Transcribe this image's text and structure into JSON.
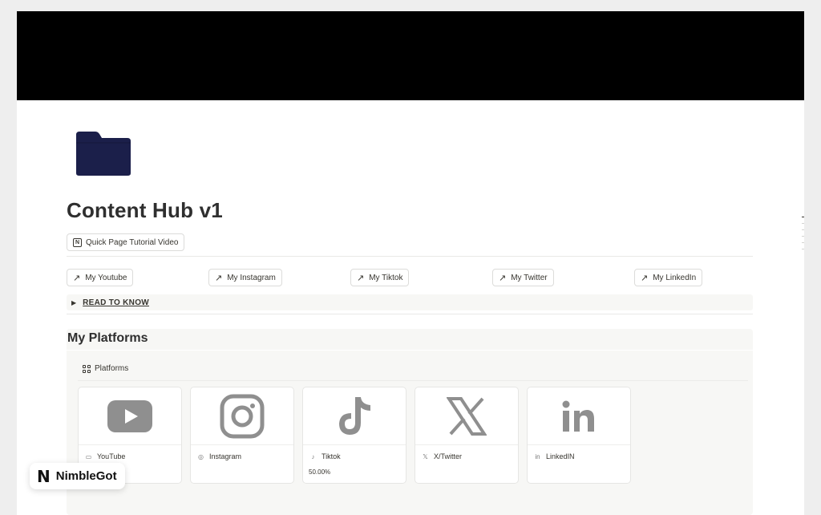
{
  "page": {
    "title": "Content Hub v1",
    "cover_color": "#000000",
    "icon": "folder-icon",
    "icon_color": "#1b1f4a"
  },
  "tutorial": {
    "label": "Quick Page Tutorial Video",
    "icon": "notion-logo-icon"
  },
  "links": [
    {
      "label": "My Youtube",
      "icon": "arrow-up-right-icon"
    },
    {
      "label": "My Instagram",
      "icon": "arrow-up-right-icon"
    },
    {
      "label": "My Tiktok",
      "icon": "arrow-up-right-icon"
    },
    {
      "label": "My Twitter",
      "icon": "arrow-up-right-icon"
    },
    {
      "label": "My LinkedIn",
      "icon": "arrow-up-right-icon"
    }
  ],
  "toggle": {
    "label": "READ TO KNOW",
    "icon": "triangle-right-icon"
  },
  "platforms_section": {
    "title": "My Platforms",
    "view_label": "Platforms",
    "view_icon": "gallery-grid-icon",
    "cards": [
      {
        "name": "YouTube",
        "icon": "youtube-icon",
        "progress": ""
      },
      {
        "name": "Instagram",
        "icon": "instagram-icon",
        "progress": ""
      },
      {
        "name": "Tiktok",
        "icon": "tiktok-icon",
        "progress": "50.00%"
      },
      {
        "name": "X/Twitter",
        "icon": "x-icon",
        "progress": ""
      },
      {
        "name": "LinkedIN",
        "icon": "linkedin-icon",
        "progress": ""
      }
    ]
  },
  "brand": {
    "name": "NimbleGot",
    "logo_letter": "N"
  },
  "colors": {
    "accent_gray": "#8a8a8a",
    "panel_bg": "#f7f7f5",
    "text": "#37352f"
  }
}
